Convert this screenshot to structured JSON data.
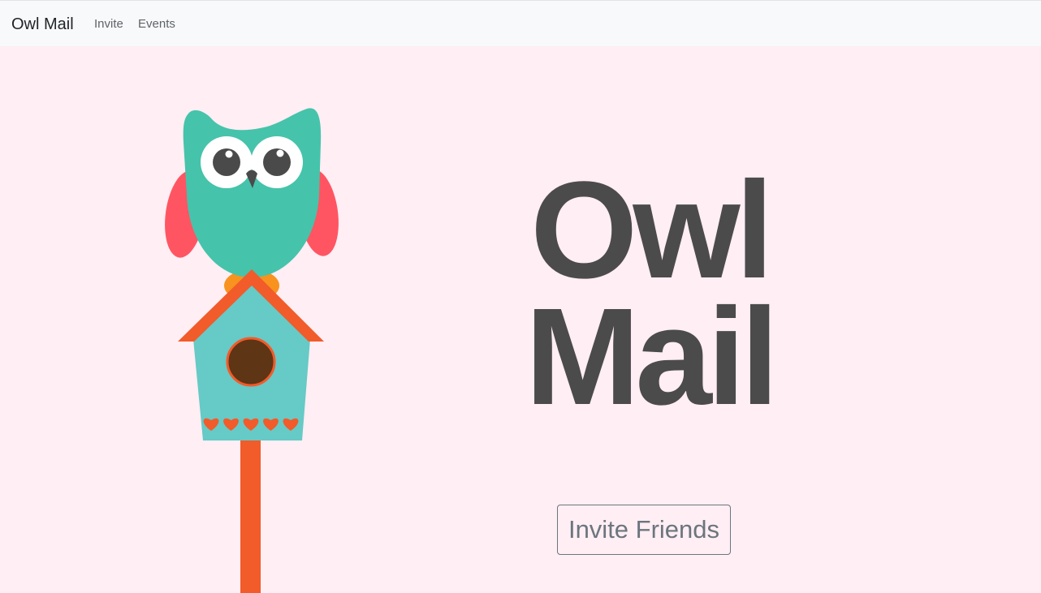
{
  "navbar": {
    "brand": "Owl Mail",
    "links": [
      {
        "label": "Invite"
      },
      {
        "label": "Events"
      }
    ]
  },
  "hero": {
    "title_line1": "Owl",
    "title_line2": "Mail",
    "cta_label": "Invite Friends"
  },
  "colors": {
    "page_background": "#ffeef4",
    "navbar_background": "#f8f9fa",
    "title_text": "#4b4b4b",
    "owl_body": "#46c3ab",
    "owl_wing": "#ff5562",
    "owl_eye": "#4a4a4a",
    "birdhouse": "#66cac6",
    "roof_and_pole": "#f25b2a",
    "birdhouse_hole": "#5e3515",
    "owl_feet": "#f7931e"
  },
  "illustration": {
    "name": "owl-on-birdhouse",
    "hearts_count": 5
  }
}
